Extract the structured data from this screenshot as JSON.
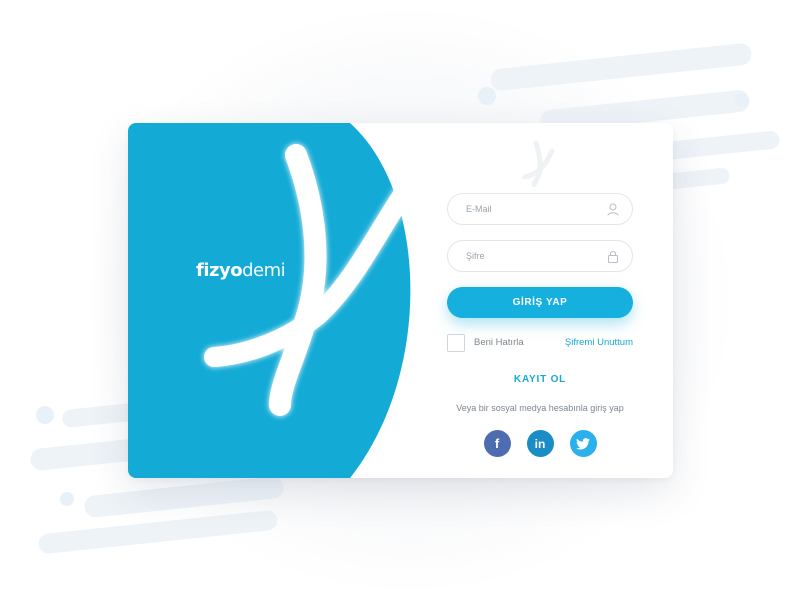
{
  "brand": {
    "name_bold": "fizyo",
    "name_light": "demi",
    "primary_color": "#15b0dd",
    "panel_color": "#13aad6"
  },
  "login_form": {
    "email_placeholder": "E-Mail",
    "password_placeholder": "Şifre",
    "login_button": "GİRİŞ YAP",
    "remember_me": "Beni Hatırla",
    "forgot_password": "Şifremi Unuttum",
    "register": "KAYIT OL",
    "social_prompt": "Veya bir sosyal medya hesabınla giriş yap"
  },
  "social": {
    "facebook": {
      "glyph": "f",
      "icon": "facebook-icon",
      "color": "#4e6db0"
    },
    "linkedin": {
      "glyph": "in",
      "icon": "linkedin-icon",
      "color": "#1a8cc6"
    },
    "twitter": {
      "icon": "twitter-bird-icon",
      "color": "#2ab0ea"
    }
  },
  "icons": {
    "email_field": "user-icon",
    "password_field": "lock-icon"
  }
}
